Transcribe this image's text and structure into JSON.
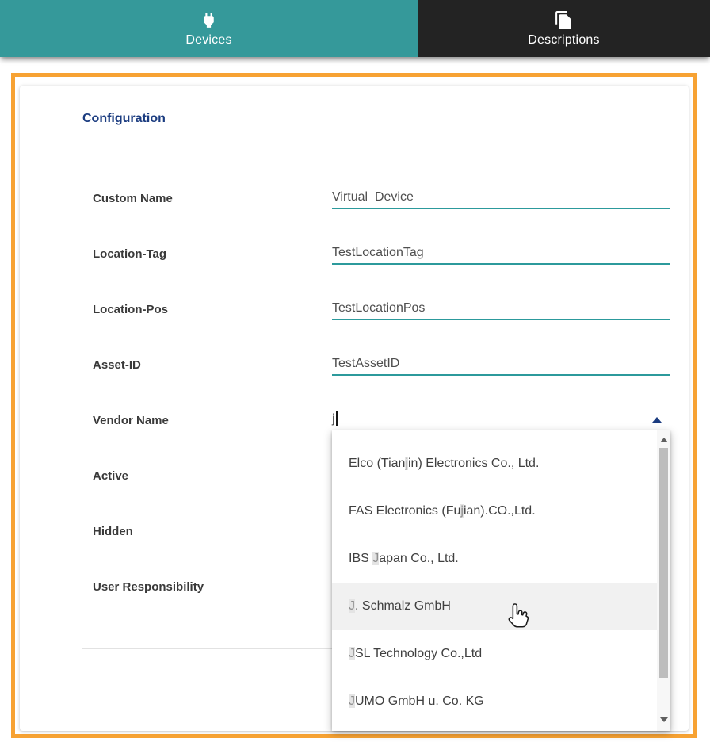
{
  "tabs": [
    {
      "label": "Devices",
      "icon": "power-plug-icon"
    },
    {
      "label": "Descriptions",
      "icon": "file-copy-icon"
    }
  ],
  "panel": {
    "heading": "Configuration",
    "fields": [
      {
        "label": "Custom Name",
        "value": "Virtual  Device"
      },
      {
        "label": "Location-Tag",
        "value": "TestLocationTag"
      },
      {
        "label": "Location-Pos",
        "value": "TestLocationPos"
      },
      {
        "label": "Asset-ID",
        "value": "TestAssetID"
      },
      {
        "label": "Vendor Name",
        "value": "j"
      },
      {
        "label": "Active",
        "value": ""
      },
      {
        "label": "Hidden",
        "value": ""
      },
      {
        "label": "User Responsibility",
        "value": ""
      }
    ]
  },
  "dropdown": {
    "items": [
      {
        "pre": "Elco (Tian",
        "match": "j",
        "post": "in) Electronics Co., Ltd.",
        "hovered": false
      },
      {
        "pre": "FAS Electronics (Fu",
        "match": "j",
        "post": "ian).CO.,Ltd.",
        "hovered": false
      },
      {
        "pre": "IBS ",
        "match": "J",
        "post": "apan Co., Ltd.",
        "hovered": false
      },
      {
        "pre": "",
        "match": "J",
        "post": ". Schmalz GmbH",
        "hovered": true
      },
      {
        "pre": "",
        "match": "J",
        "post": "SL Technology Co.,Ltd",
        "hovered": false
      },
      {
        "pre": "",
        "match": "J",
        "post": "UMO GmbH u. Co. KG",
        "hovered": false
      }
    ]
  },
  "colors": {
    "tab_active_bg": "#35999A",
    "tab_inactive_bg": "#232323",
    "panel_border": "#F7A233",
    "heading_text": "#1B3C80",
    "input_underline": "#2C9A9C",
    "option_hover_bg": "#F1F1F1",
    "match_highlight_bg": "#E4E4E4"
  }
}
